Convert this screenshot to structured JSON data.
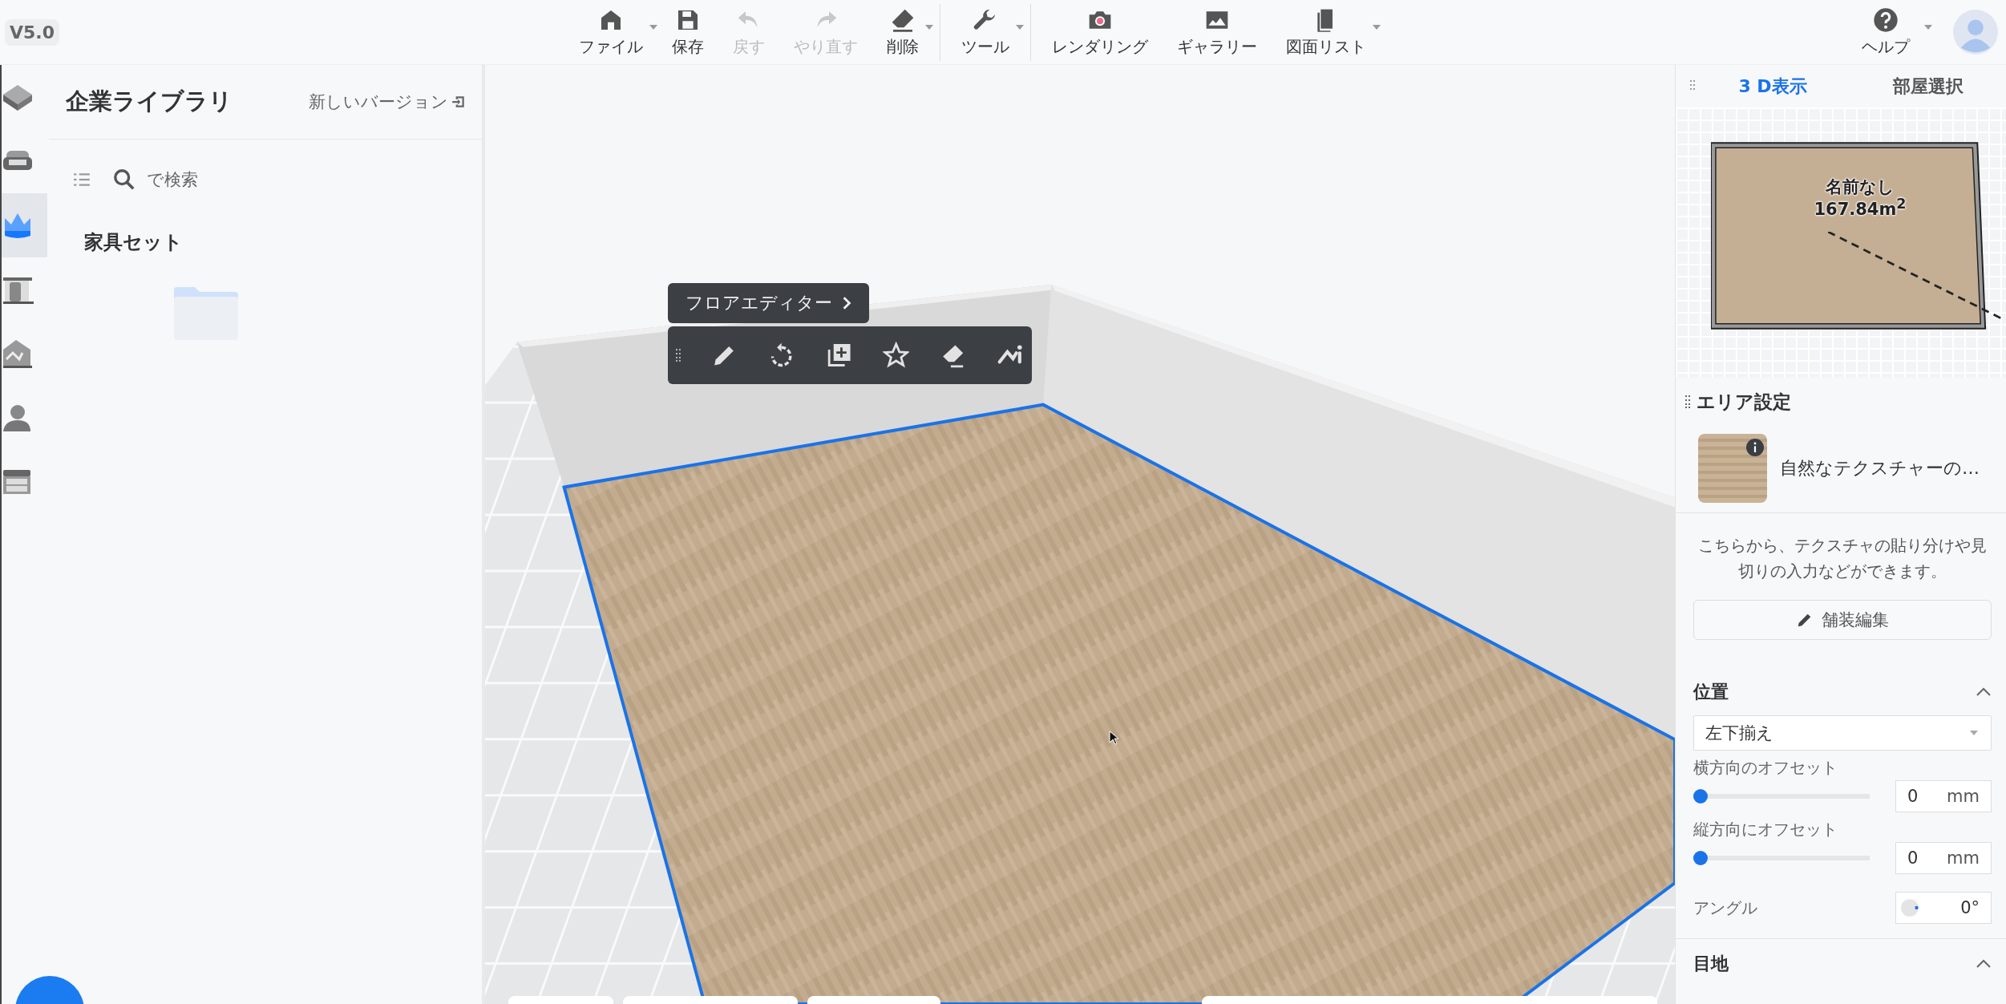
{
  "app": {
    "version": "V5.0"
  },
  "toolbar": {
    "items": [
      {
        "label": "ファイル",
        "disabled": false,
        "dropdown": true
      },
      {
        "label": "保存",
        "disabled": false,
        "dropdown": false
      },
      {
        "label": "戻す",
        "disabled": true,
        "dropdown": false
      },
      {
        "label": "やり直す",
        "disabled": true,
        "dropdown": false
      },
      {
        "label": "削除",
        "disabled": false,
        "dropdown": true
      },
      {
        "label": "ツール",
        "disabled": false,
        "dropdown": true
      },
      {
        "label": "レンダリング",
        "disabled": false,
        "dropdown": false
      },
      {
        "label": "ギャラリー",
        "disabled": false,
        "dropdown": false
      },
      {
        "label": "図面リスト",
        "disabled": false,
        "dropdown": true
      }
    ],
    "help": {
      "label": "ヘルプ",
      "dropdown": true
    }
  },
  "sidebar": {
    "items": [
      {
        "selected": false
      },
      {
        "selected": false
      },
      {
        "selected": true
      },
      {
        "selected": false
      },
      {
        "selected": false
      },
      {
        "selected": false
      },
      {
        "selected": false
      }
    ]
  },
  "library": {
    "title": "企業ライブラリ",
    "new_version_link": "新しいバージョン",
    "search": {
      "placeholder": "で検索"
    },
    "section": "家具セット"
  },
  "viewport": {
    "floor_editor": {
      "label": "フロアエディター"
    }
  },
  "right_panel": {
    "tabs": [
      {
        "label": "3 D表示",
        "selected": true
      },
      {
        "label": "部屋選択",
        "selected": false
      }
    ],
    "minimap": {
      "room_name": "名前なし",
      "area": "167.84m$^{2}$"
    },
    "area_settings": {
      "title": "エリア設定",
      "material": "自然なテクスチャーの…",
      "description": "こちらから、テクスチャの貼り分けや見切りの入力などができます。",
      "edit_button": "舗装編集",
      "sections": [
        {
          "title": "位置",
          "expanded": true
        },
        {
          "title": "目地",
          "expanded": true
        }
      ],
      "alignment": "左下揃え",
      "offsets": [
        {
          "label": "横方向のオフセット",
          "level": 0,
          "value": "0",
          "unit": "mm"
        },
        {
          "label": "縦方向にオフセット",
          "level": 0,
          "value": "0",
          "unit": "mm"
        }
      ],
      "angle": {
        "label": "アングル",
        "value": "0°"
      }
    }
  }
}
